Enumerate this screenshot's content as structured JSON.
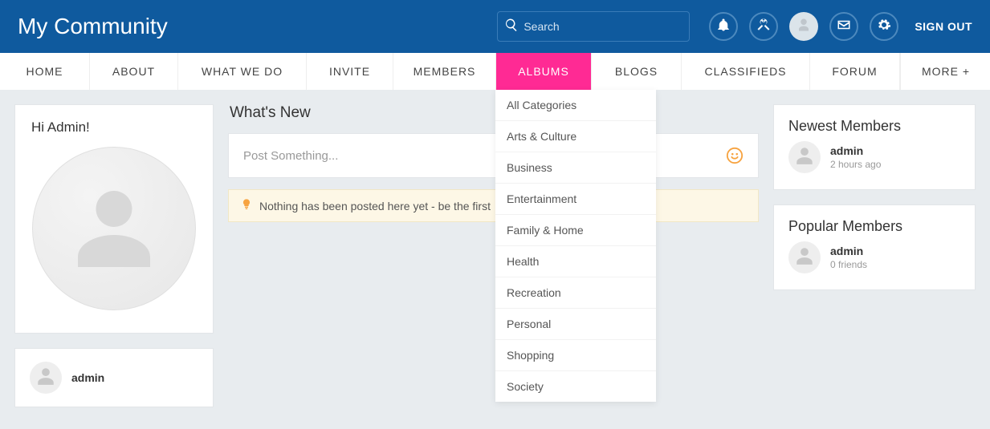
{
  "header": {
    "site_title": "My Community",
    "search_placeholder": "Search",
    "signout_label": "SIGN OUT"
  },
  "nav": {
    "items": [
      "HOME",
      "ABOUT",
      "WHAT WE DO",
      "INVITE",
      "MEMBERS",
      "ALBUMS",
      "BLOGS",
      "CLASSIFIEDS",
      "FORUM"
    ],
    "more_label": "MORE +"
  },
  "dropdown": {
    "items": [
      "All Categories",
      "Arts & Culture",
      "Business",
      "Entertainment",
      "Family & Home",
      "Health",
      "Recreation",
      "Personal",
      "Shopping",
      "Society"
    ]
  },
  "left": {
    "greeting": "Hi Admin!",
    "username": "admin"
  },
  "center": {
    "section_title": "What's New",
    "poster_placeholder": "Post Something...",
    "empty_notice": "Nothing has been posted here yet - be the first"
  },
  "right": {
    "newest_title": "Newest Members",
    "newest": {
      "name": "admin",
      "sub": "2 hours ago"
    },
    "popular_title": "Popular Members",
    "popular": {
      "name": "admin",
      "sub": "0 friends"
    }
  }
}
